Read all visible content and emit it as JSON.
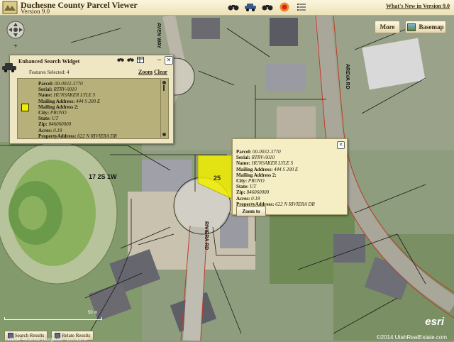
{
  "header": {
    "title": "Duchesne County Parcel Viewer",
    "version": "Version 9.0",
    "whats_new": "What's New in Version 9.0",
    "tools": [
      "binoculars-icon",
      "car-icon",
      "binoculars-icon",
      "record-icon",
      "list-icon"
    ]
  },
  "map": {
    "buttons": {
      "more": "More",
      "basemap": "Basemap"
    },
    "labels": {
      "section": "17 2S 1W",
      "street1": "AREVA RD",
      "street2": "RIVIERA RD",
      "street3": "AVEN WAY",
      "parcel": "25"
    },
    "scale": "50 m",
    "attribution": "©2014 UtahRealEstate.com",
    "esri": "esri",
    "coords": "Latitude: 40.30762 | Longitude: -110.015797",
    "colors": {
      "highlight": "#f2ee00",
      "parcel_line": "#1a1a1a",
      "road_line": "#c0392b"
    }
  },
  "widget": {
    "title": "Enhanced Search Widget",
    "features_selected": "Features Selected: 4",
    "zoom": "Zoom",
    "clear": "Clear",
    "record": {
      "parcel": "00-0032-3770",
      "serial": "RTRV-0010",
      "name": "HUNSAKER LYLE S",
      "mailing_address": "444 S 200 E",
      "mailing_address2_label": "Mailing Address 2:",
      "city": "PROVO",
      "state": "UT",
      "zip": "846060000",
      "acres": "0.18",
      "property_address": "622 N RIVIERA DR"
    }
  },
  "popup": {
    "record": {
      "parcel": "00-0032-3770",
      "serial": "RTRV-0010",
      "name": "HUNSAKER LYLE S",
      "mailing_address": "444 S 200 E",
      "mailing_address2_label": "Mailing Address 2:",
      "city": "PROVO",
      "state": "UT",
      "zip": "846060000",
      "acres": "0.18",
      "property_address": "622 N RIVIERA DR"
    },
    "zoom_to": "Zoom to"
  },
  "bottom": {
    "tabs": [
      "Search Results",
      "Relate Results"
    ]
  },
  "labels": {
    "parcel": "Parcel:",
    "serial": "Serial:",
    "name": "Name:",
    "mailing_address": "Mailing Address:",
    "city": "City:",
    "state": "State:",
    "zip": "Zip:",
    "acres": "Acres:",
    "property_address": "PropertyAddress:"
  }
}
